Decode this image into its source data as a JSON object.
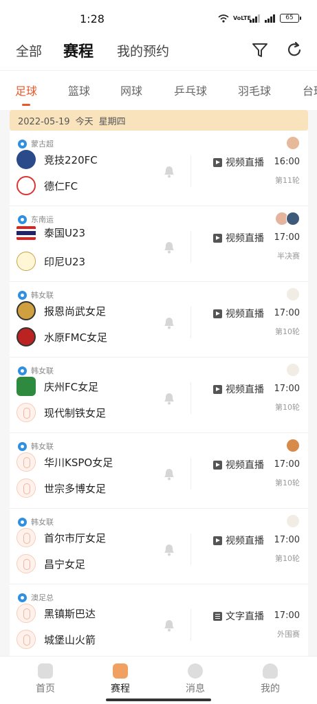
{
  "status_bar": {
    "time": "1:28",
    "volte": "VoLTE",
    "battery": "65"
  },
  "top_nav": {
    "tabs": [
      {
        "label": "全部"
      },
      {
        "label": "赛程"
      },
      {
        "label": "我的预约"
      }
    ],
    "filter_icon": "filter-icon",
    "refresh_icon": "refresh-icon"
  },
  "sport_tabs": [
    {
      "label": "足球"
    },
    {
      "label": "篮球"
    },
    {
      "label": "网球"
    },
    {
      "label": "乒乓球"
    },
    {
      "label": "羽毛球"
    },
    {
      "label": "台球"
    }
  ],
  "date_header": {
    "date": "2022-05-19",
    "today": "今天",
    "weekday": "星期四"
  },
  "matches": [
    {
      "league": "蒙古超",
      "team1": "竞技220FC",
      "team2": "德仁FC",
      "broadcast": "视频直播",
      "time": "16:00",
      "round": "第11轮"
    },
    {
      "league": "东南运",
      "team1": "泰国U23",
      "team2": "印尼U23",
      "broadcast": "视频直播",
      "time": "17:00",
      "round": "半决赛"
    },
    {
      "league": "韩女联",
      "team1": "报恩尚武女足",
      "team2": "水原FMC女足",
      "broadcast": "视频直播",
      "time": "17:00",
      "round": "第10轮"
    },
    {
      "league": "韩女联",
      "team1": "庆州FC女足",
      "team2": "现代制铁女足",
      "broadcast": "视频直播",
      "time": "17:00",
      "round": "第10轮"
    },
    {
      "league": "韩女联",
      "team1": "华川KSPO女足",
      "team2": "世宗多博女足",
      "broadcast": "视频直播",
      "time": "17:00",
      "round": "第10轮"
    },
    {
      "league": "韩女联",
      "team1": "首尔市厅女足",
      "team2": "昌宁女足",
      "broadcast": "视频直播",
      "time": "17:00",
      "round": "第10轮"
    },
    {
      "league": "澳足总",
      "team1": "黑镇斯巴达",
      "team2": "城堡山火箭",
      "broadcast": "文字直播",
      "time": "17:00",
      "round": "外围赛"
    }
  ],
  "bottom_nav": [
    {
      "label": "首页"
    },
    {
      "label": "赛程"
    },
    {
      "label": "消息"
    },
    {
      "label": "我的"
    }
  ],
  "colors": {
    "accent": "#e8582a",
    "date_bg": "#f8e3bd",
    "league_icon": "#2f8fe0"
  }
}
